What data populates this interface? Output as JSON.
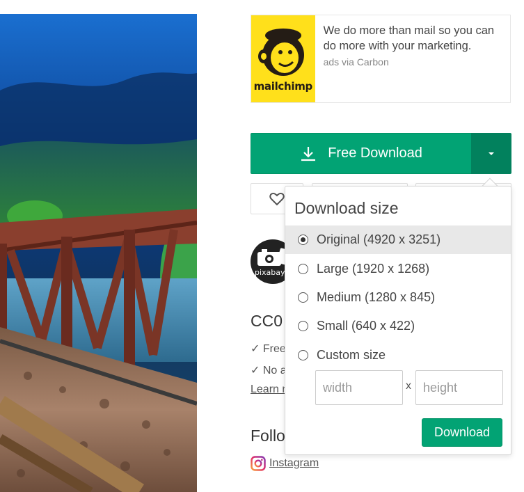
{
  "ad": {
    "brand": "mailchimp",
    "copy": "We do more than mail so you can do more with your marketing.",
    "via": "ads via Carbon",
    "logo_icon": "freddie-chimp-icon",
    "brand_color": "#ffe01b"
  },
  "download": {
    "label": "Free Download",
    "icon": "download-icon",
    "toggle_icon": "caret-down-icon",
    "accent": "#02a374"
  },
  "actions": {
    "like_icon": "heart-icon"
  },
  "uploader": {
    "avatar_text": "pixabay"
  },
  "license": {
    "title": "CC0 l",
    "check1": "✓ Free",
    "check2": "✓ No a",
    "learn": "Learn m"
  },
  "follow": {
    "title": "Follo",
    "instagram": "Instagram"
  },
  "panel": {
    "title": "Download size",
    "options": [
      {
        "label": "Original (4920 x 3251)",
        "selected": true
      },
      {
        "label": "Large (1920 x 1268)",
        "selected": false
      },
      {
        "label": "Medium (1280 x 845)",
        "selected": false
      },
      {
        "label": "Small (640 x 422)",
        "selected": false
      },
      {
        "label": "Custom size",
        "selected": false
      }
    ],
    "width_placeholder": "width",
    "height_placeholder": "height",
    "separator": "x",
    "download_label": "Download"
  }
}
